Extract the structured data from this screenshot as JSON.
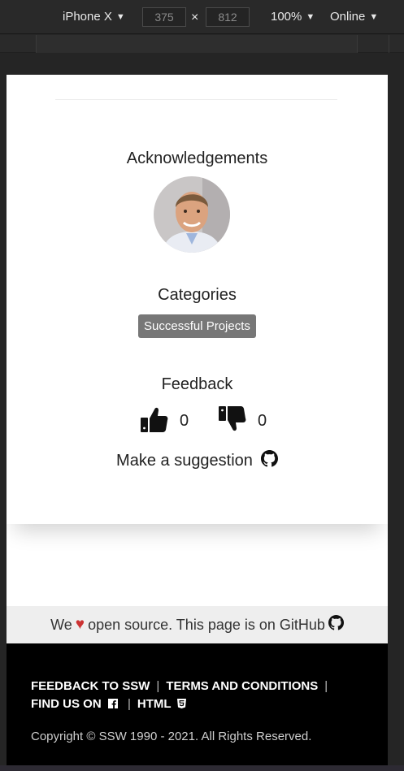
{
  "devtools": {
    "device": "iPhone X",
    "width": "375",
    "height": "812",
    "times": "×",
    "zoom": "100%",
    "network": "Online",
    "caret": "▼"
  },
  "sections": {
    "acknowledgements_title": "Acknowledgements",
    "categories_title": "Categories",
    "category_badge": "Successful Projects",
    "feedback_title": "Feedback"
  },
  "feedback": {
    "likes": "0",
    "dislikes": "0",
    "suggestion_label": "Make a suggestion"
  },
  "github_banner": {
    "prefix": "We",
    "heart": "♥",
    "suffix": "open source. This page is on GitHub"
  },
  "footer": {
    "feedback_link": "FEEDBACK TO SSW",
    "terms_link": "TERMS AND CONDITIONS",
    "find_us_link": "FIND US ON",
    "html_link": "HTML",
    "separator": "|",
    "copyright": "Copyright © SSW 1990 - 2021. All Rights Reserved."
  },
  "icons": {
    "thumbs_up": "thumbs-up-icon",
    "thumbs_down": "thumbs-down-icon",
    "github": "github-icon",
    "facebook": "facebook-icon",
    "html5": "html5-icon"
  },
  "colors": {
    "badge": "#777777",
    "heart": "#cc3333",
    "footer": "#000000"
  }
}
